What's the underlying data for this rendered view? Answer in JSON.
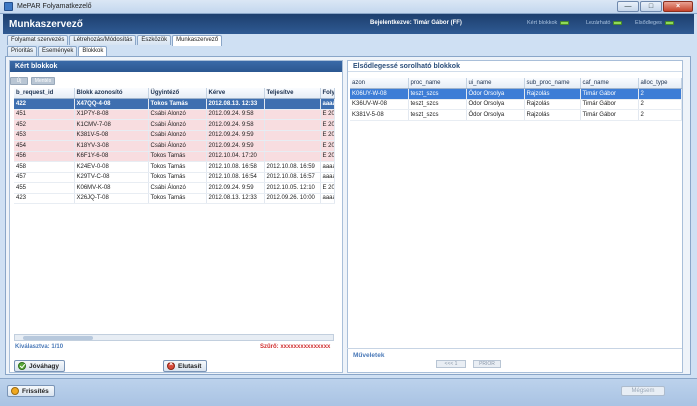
{
  "window": {
    "title": "MePAR Folyamatkezelő",
    "minimize": "—",
    "maximize": "□",
    "close": "×"
  },
  "header": {
    "title": "Munkaszervező",
    "user_label": "Bejelentkezve: Timár Gábor (FF)",
    "status": [
      {
        "label": "Kért blokkok"
      },
      {
        "label": "Lezárható"
      },
      {
        "label": "Elsődleges"
      }
    ]
  },
  "tabs_main": [
    {
      "label": "Folyamat szervezés",
      "active": false
    },
    {
      "label": "Létrehozás/Módosítás",
      "active": false
    },
    {
      "label": "Eszközök",
      "active": false
    },
    {
      "label": "Munkaszervező",
      "active": true
    }
  ],
  "tabs_sub": [
    {
      "label": "Prioritás",
      "active": false
    },
    {
      "label": "Események",
      "active": false
    },
    {
      "label": "Blokkok",
      "active": true
    }
  ],
  "left_panel": {
    "title": "Kért blokkok",
    "mini_buttons": [
      "Új",
      "Mentés"
    ],
    "columns": [
      "b_request_id",
      "Blokk azonosító",
      "Ügyintéző",
      "Kérve",
      "Teljesítve",
      "Foly"
    ],
    "rows": [
      {
        "style": "sel",
        "cells": [
          "422",
          "X47QQ-4-08",
          "Tokos Tamás",
          "2012.08.13. 12:33",
          "",
          "aaaa"
        ]
      },
      {
        "style": "pink",
        "cells": [
          "451",
          "X1P7Y-8-08",
          "Csábi Álonzó",
          "2012.09.24. 9:58",
          "",
          "E 20"
        ]
      },
      {
        "style": "pink",
        "cells": [
          "452",
          "K1CMV-7-08",
          "Csábi Álonzó",
          "2012.09.24. 9:58",
          "",
          "E 20"
        ]
      },
      {
        "style": "pink",
        "cells": [
          "453",
          "K381V-5-08",
          "Csábi Álonzó",
          "2012.09.24. 9:59",
          "",
          "E 20"
        ]
      },
      {
        "style": "pink",
        "cells": [
          "454",
          "K18YV-3-08",
          "Csábi Álonzó",
          "2012.09.24. 9:59",
          "",
          "E 20"
        ]
      },
      {
        "style": "pink",
        "cells": [
          "456",
          "K6F1Y-6-08",
          "Tokos Tamás",
          "2012.10.04. 17:20",
          "",
          "E 20"
        ]
      },
      {
        "style": "plain",
        "cells": [
          "458",
          "K24EV-0-08",
          "Tokos Tamás",
          "2012.10.08. 16:58",
          "2012.10.08. 16:59",
          "aaaa"
        ]
      },
      {
        "style": "plain",
        "cells": [
          "457",
          "K29TV-C-08",
          "Tokos Tamás",
          "2012.10.08. 16:54",
          "2012.10.08. 16:57",
          "aaaa"
        ]
      },
      {
        "style": "plain",
        "cells": [
          "455",
          "K06MV-K-08",
          "Csábi Álonzó",
          "2012.09.24. 9:59",
          "2012.10.05. 12:10",
          "E 20"
        ]
      },
      {
        "style": "plain",
        "cells": [
          "423",
          "X26JQ-T-08",
          "Tokos Tamás",
          "2012.08.13. 12:33",
          "2012.09.26. 10:00",
          "aaaa"
        ]
      }
    ],
    "footer_count": "Kiválasztva: 1/10",
    "footer_filter": "Szűrő: xxxxxxxxxxxxxxx",
    "approve_label": "Jóváhagy",
    "reject_label": "Elutasít"
  },
  "right_panel": {
    "title": "Elsődlegessé sorolható blokkok",
    "columns": [
      "azon",
      "proc_name",
      "ui_name",
      "sub_proc_name",
      "caf_name",
      "alloc_type"
    ],
    "rows": [
      {
        "style": "sel",
        "cells": [
          "K06UY-W-08",
          "teszt_szcs",
          "Ödor Orsolya",
          "Rajzolás",
          "Timár Gábor",
          "2"
        ]
      },
      {
        "style": "plain",
        "cells": [
          "K36UV-W-08",
          "teszt_szcs",
          "Ödor Orsolya",
          "Rajzolás",
          "Timár Gábor",
          "2"
        ]
      },
      {
        "style": "plain",
        "cells": [
          "K381V-5-08",
          "teszt_szcs",
          "Ödor Orsolya",
          "Rajzolás",
          "Timár Gábor",
          "2"
        ]
      }
    ],
    "actions_title": "Műveletek",
    "actions": [
      "<<< 1",
      "PRIOR"
    ]
  },
  "bottom": {
    "refresh_label": "Frissítés",
    "cancel_label": "Mégsem"
  }
}
